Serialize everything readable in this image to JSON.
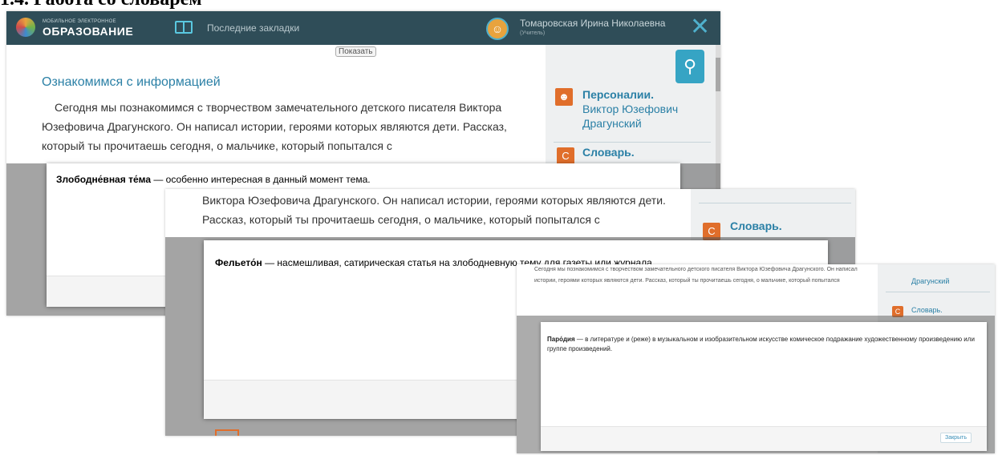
{
  "slide_title": "1.4. Работа со словарём",
  "screen1": {
    "logo_small": "МОБИЛЬНОЕ ЭЛЕКТРОННОЕ",
    "logo_big": "ОБРАЗОВАНИЕ",
    "bookmarks": "Последние закладки",
    "user_name": "Томаровская Ирина Николаевна",
    "user_role": "(Учитель)",
    "close_glyph": "✕",
    "show_button": "Показать",
    "heading": "Ознакомимся с информацией",
    "paragraph": "Сегодня мы познакомимся с творчеством замечательного детского писателя Виктора Юзефовича Драгунского. Он написал истории, героями которых являются дети. Рассказ, который ты прочитаешь сегодня, о мальчике, который попытался с",
    "sidebar": {
      "personalia_title": "Персоналии.",
      "personalia_line1": "Виктор Юзефович",
      "personalia_line2": "Драгунский",
      "dictionary_title": "Словарь."
    },
    "modal_term": "Злободне́вная те́ма",
    "modal_definition": " — особенно интересная в  данный момент тема."
  },
  "screen2": {
    "paragraph": "Виктора Юзефовича Драгунского. Он написал истории, героями которых являются дети. Рассказ, который ты прочитаешь сегодня, о мальчике, который попытался с",
    "dictionary_title": "Словарь.",
    "modal_term": "Фельето́н",
    "modal_definition": " — насмешливая, сатирическая статья на  злободневную тему для газеты или журнала."
  },
  "screen3": {
    "paragraph": "Сегодня мы познакомимся с творчеством замечательного детского писателя Виктора Юзефовича Драгунского. Он написал истории, героями которых являются дети. Рассказ, который ты прочитаешь сегодня, о мальчике, который попытался",
    "sidebar_personalia": "Драгунский",
    "dictionary_title": "Словарь.",
    "modal_term": "Паро́дия",
    "modal_definition": " — в литературе и (реже) в музыкальном и изобразительном искусстве комическое подражание художественному произведению или группе произведений.",
    "close_button": "Закрыть"
  },
  "colors": {
    "header": "#2f4d58",
    "accent": "#2b80a6",
    "icon_orange": "#e06e2b"
  }
}
